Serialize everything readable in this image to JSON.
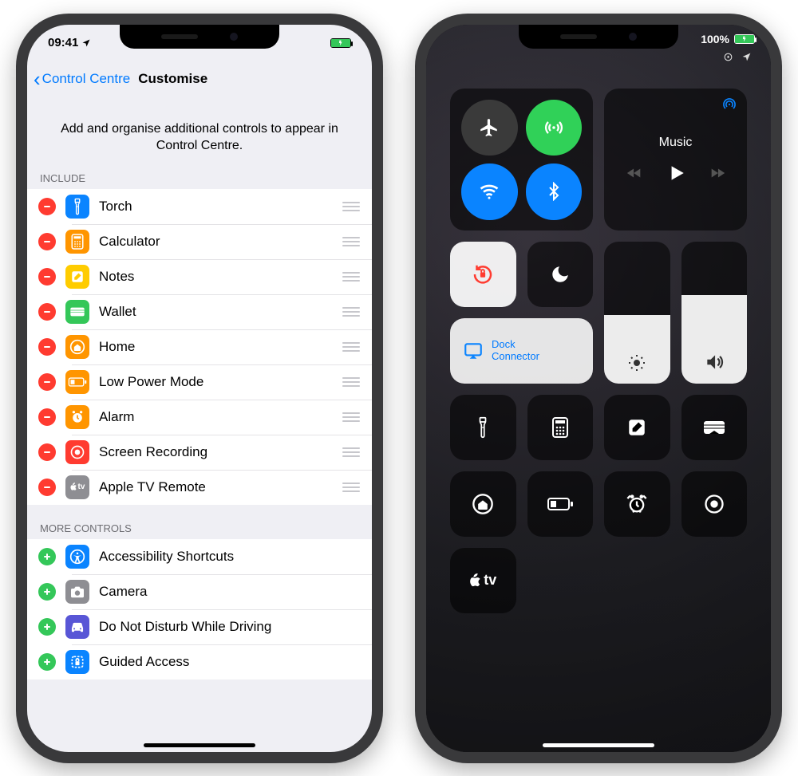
{
  "left": {
    "status": {
      "time": "09:41"
    },
    "nav": {
      "back": "Control Centre",
      "title": "Customise"
    },
    "description": "Add and organise additional controls to appear in Control Centre.",
    "include_header": "INCLUDE",
    "more_header": "MORE CONTROLS",
    "include": [
      {
        "label": "Torch",
        "icon": "torch",
        "color": "#0a84ff"
      },
      {
        "label": "Calculator",
        "icon": "calculator",
        "color": "#ff9500"
      },
      {
        "label": "Notes",
        "icon": "notes",
        "color": "#ffcc00"
      },
      {
        "label": "Wallet",
        "icon": "wallet",
        "color": "#34c759"
      },
      {
        "label": "Home",
        "icon": "home",
        "color": "#ff9500"
      },
      {
        "label": "Low Power Mode",
        "icon": "lowpower",
        "color": "#ff9500"
      },
      {
        "label": "Alarm",
        "icon": "alarm",
        "color": "#ff9500"
      },
      {
        "label": "Screen Recording",
        "icon": "record",
        "color": "#ff3b30"
      },
      {
        "label": "Apple TV Remote",
        "icon": "tvremote",
        "color": "#8e8e93"
      }
    ],
    "more": [
      {
        "label": "Accessibility Shortcuts",
        "icon": "accessibility",
        "color": "#0a84ff"
      },
      {
        "label": "Camera",
        "icon": "camera",
        "color": "#8e8e93"
      },
      {
        "label": "Do Not Disturb While Driving",
        "icon": "car",
        "color": "#5856d6"
      },
      {
        "label": "Guided Access",
        "icon": "guided",
        "color": "#0a84ff"
      }
    ]
  },
  "right": {
    "status": {
      "battery_pct": "100%"
    },
    "media": {
      "label": "Music"
    },
    "mirror": {
      "line1": "Dock",
      "line2": "Connector"
    },
    "tv_label": "tv"
  }
}
